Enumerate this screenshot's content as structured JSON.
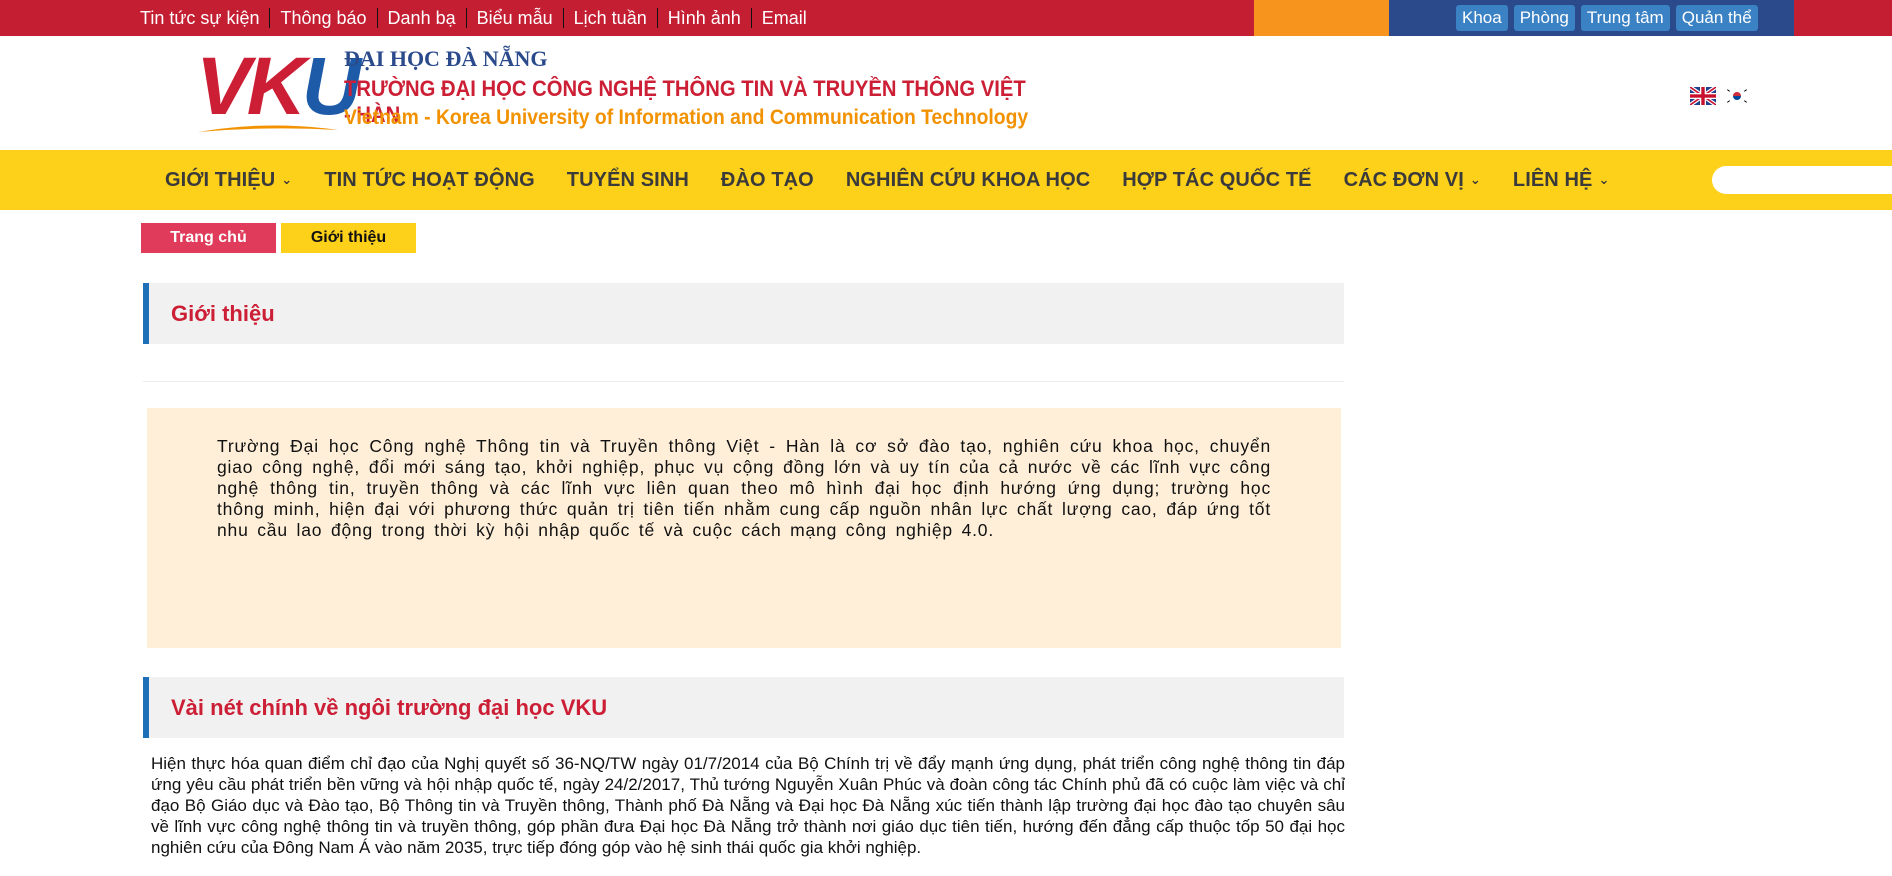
{
  "topbar": {
    "links": [
      "Tin tức sự kiện",
      "Thông báo",
      "Danh bạ",
      "Biểu mẫu",
      "Lịch tuần",
      "Hình ảnh",
      "Email"
    ],
    "unit_buttons": [
      "Khoa",
      "Phòng",
      "Trung tâm",
      "Quản thể"
    ],
    "colors": {
      "red": "#c41e33",
      "orange": "#f7941d",
      "blue": "#2b4a8b"
    }
  },
  "header": {
    "logo_letters": {
      "v": "V",
      "k": "K",
      "u": "U"
    },
    "logo_line1": "ĐẠI HỌC ĐÀ NẴNG",
    "logo_line2": "TRƯỜNG ĐẠI HỌC CÔNG NGHỆ THÔNG TIN VÀ TRUYỀN THÔNG VIỆT - HÀN",
    "logo_line3": "Vietnam - Korea University of Information and Communication Technology",
    "flags": [
      "uk-flag-icon",
      "korea-flag-icon"
    ]
  },
  "nav": {
    "items": [
      {
        "label": "GIỚI THIỆU",
        "dropdown": true
      },
      {
        "label": "TIN TỨC HOẠT ĐỘNG",
        "dropdown": false
      },
      {
        "label": "TUYỂN SINH",
        "dropdown": false
      },
      {
        "label": "ĐÀO TẠO",
        "dropdown": false
      },
      {
        "label": "NGHIÊN CỨU KHOA HỌC",
        "dropdown": false
      },
      {
        "label": "HỢP TÁC QUỐC TẾ",
        "dropdown": false
      },
      {
        "label": "CÁC ĐƠN VỊ",
        "dropdown": true
      },
      {
        "label": "LIÊN HỆ",
        "dropdown": true
      }
    ],
    "search_placeholder": "",
    "color": "#fdd01a"
  },
  "breadcrumb": {
    "home": "Trang chủ",
    "current": "Giới thiệu"
  },
  "main": {
    "section1_title": "Giới thiệu",
    "intro": "Trường Đại học Công nghệ Thông tin và Truyền thông Việt - Hàn là cơ sở đào tạo, nghiên cứu khoa học, chuyển giao công nghệ, đổi mới sáng tạo, khởi nghiệp, phục vụ cộng đồng lớn và uy tín của cả nước về các lĩnh vực công nghệ thông tin, truyền thông và các lĩnh vực liên quan theo mô hình đại học định hướng ứng dụng; trường học thông minh, hiện đại với phương thức quản trị tiên tiến nhằm cung cấp nguồn nhân lực chất lượng cao, đáp ứng tốt nhu cầu lao động trong thời kỳ hội nhập quốc tế và cuộc cách mạng công nghiệp 4.0.",
    "section2_title": "Vài nét chính về ngôi trường đại học VKU",
    "paragraph": "Hiện thực hóa quan điểm chỉ đạo của Nghị quyết số 36-NQ/TW ngày 01/7/2014 của Bộ Chính trị về đẩy mạnh ứng dụng, phát triển công nghệ thông tin đáp ứng yêu cầu phát triển bền vững và hội nhập quốc tế, ngày 24/2/2017, Thủ tướng Nguyễn Xuân Phúc và đoàn công tác Chính phủ đã có cuộc làm việc và chỉ đạo Bộ Giáo dục và Đào tạo, Bộ Thông tin và Truyền thông, Thành phố Đà Nẵng và Đại học Đà Nẵng xúc tiến thành lập trường đại học đào tạo chuyên sâu về lĩnh vực công nghệ thông tin và truyền thông, góp phần đưa Đại học Đà Nẵng trở thành nơi giáo dục tiên tiến, hướng đến đẳng cấp thuộc tốp 50 đại học nghiên cứu của Đông Nam Á vào năm 2035, trực tiếp đóng góp vào hệ sinh thái quốc gia khởi nghiệp."
  }
}
